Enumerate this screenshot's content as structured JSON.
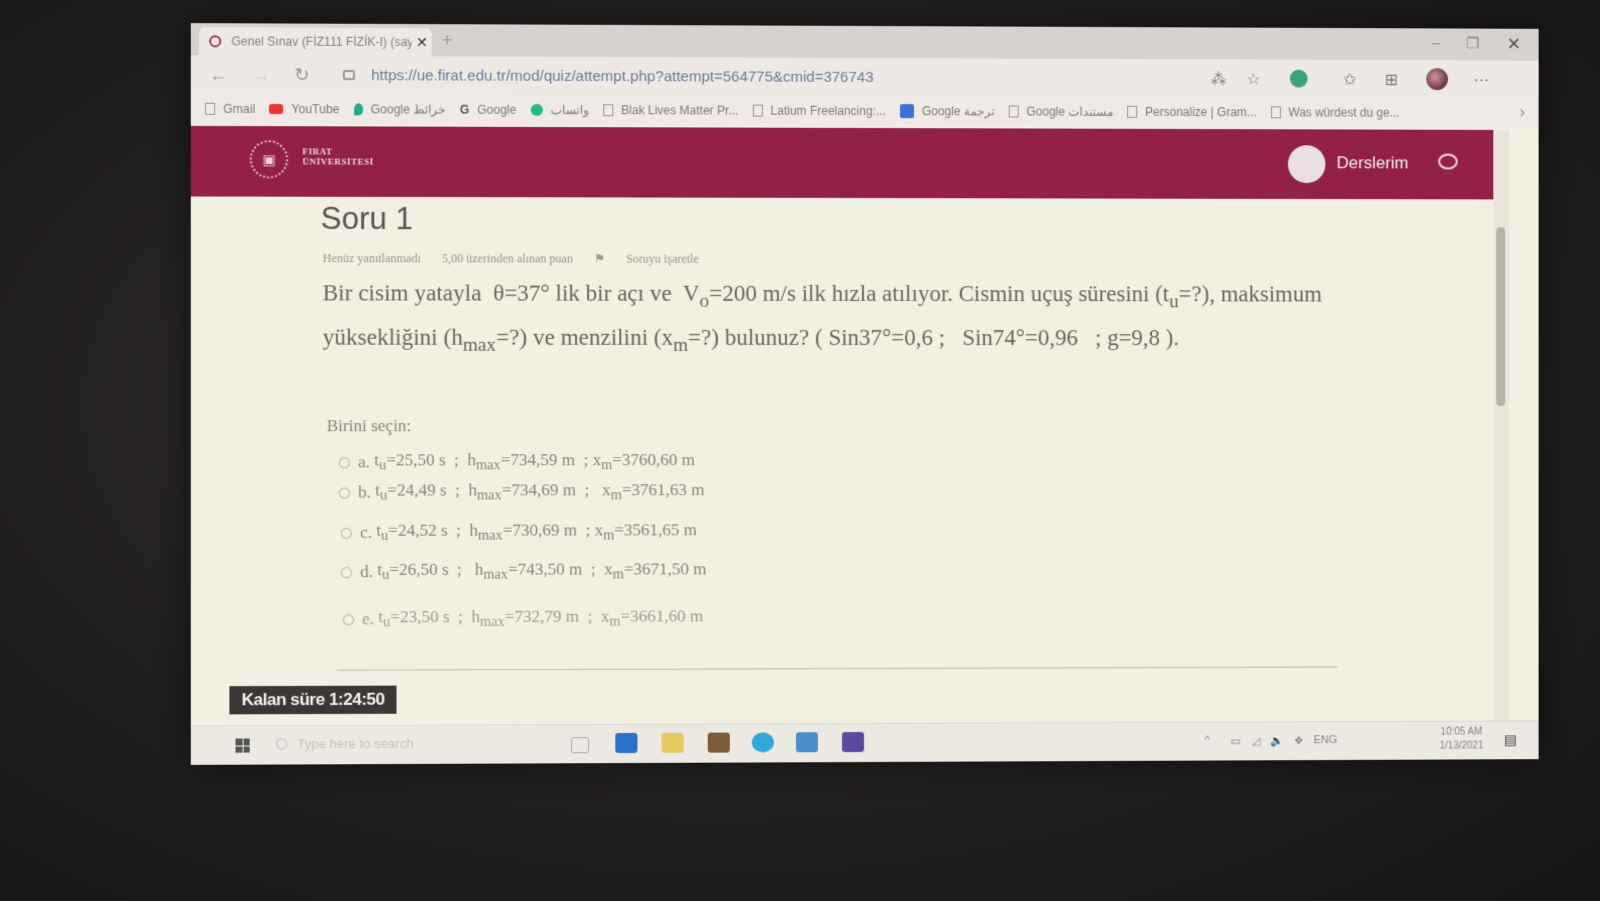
{
  "browser": {
    "tab_title": "Genel Sınav (FİZ111 FİZİK-I) (say",
    "tab_close": "✕",
    "new_tab": "+",
    "url": "https://ue.firat.edu.tr/mod/quiz/attempt.php?attempt=564775&cmid=376743",
    "bookmarks": [
      {
        "label": "Gmail",
        "icon": "page"
      },
      {
        "label": "YouTube",
        "icon": "youtube"
      },
      {
        "label": "Google خرائط",
        "icon": "pin"
      },
      {
        "label": "Google",
        "icon": "g"
      },
      {
        "label": "واتساب",
        "icon": "whatsapp"
      },
      {
        "label": "Blak Lives Matter Pr...",
        "icon": "page"
      },
      {
        "label": "Latium Freelancing:...",
        "icon": "page"
      },
      {
        "label": "Google ترجمة",
        "icon": "translate"
      },
      {
        "label": "Google مستندات",
        "icon": "page"
      },
      {
        "label": "Personalize | Gram...",
        "icon": "page"
      },
      {
        "label": "Was würdest du ge...",
        "icon": "page"
      }
    ]
  },
  "site": {
    "logo_text_1": "FIRAT",
    "logo_text_2": "ÜNİVERSİTESİ",
    "nav_label": "Derslerim",
    "brand_color": "#922048"
  },
  "question": {
    "title": "Soru 1",
    "status": "Henüz yanıtlanmadı",
    "points": "5,00 üzerinden alınan puan",
    "flag": "Soruyu işaretle",
    "text_html": "Bir cisim yatayla&nbsp; θ=37° lik bir açı ve&nbsp; V<sub>o</sub>=200 m/s ilk hızla atılıyor. Cismin uçuş süresini (t<sub>u</sub>=?), maksimum yüksekliğini (h<sub>max</sub>=?) ve menzilini (x<sub>m</sub>=?) bulunuz? ( Sin37°=0,6 ;&nbsp;&nbsp; Sin74°=0,96&nbsp;&nbsp; ; g=9,8 ).",
    "prompt": "Birini seçin:",
    "options": [
      {
        "letter": "a.",
        "html": "t<sub>u</sub>=25,50 s&nbsp; ;&nbsp; h<sub>max</sub>=734,59 m&nbsp; ; x<sub>m</sub>=3760,60 m"
      },
      {
        "letter": "b.",
        "html": "t<sub>u</sub>=24,49 s&nbsp; ;&nbsp; h<sub>max</sub>=734,69 m&nbsp; ;&nbsp;&nbsp; x<sub>m</sub>=3761,63 m"
      },
      {
        "letter": "c.",
        "html": "t<sub>u</sub>=24,52 s&nbsp; ;&nbsp; h<sub>max</sub>=730,69 m&nbsp; ; x<sub>m</sub>=3561,65 m"
      },
      {
        "letter": "d.",
        "html": "t<sub>u</sub>=26,50 s&nbsp; ;&nbsp;&nbsp; h<sub>max</sub>=743,50 m&nbsp; ;&nbsp; x<sub>m</sub>=3671,50 m"
      },
      {
        "letter": "e.",
        "html": "t<sub>u</sub>=23,50 s&nbsp; ;&nbsp; h<sub>max</sub>=732,79 m&nbsp; ;&nbsp; x<sub>m</sub>=3661,60 m"
      }
    ]
  },
  "timer": {
    "label": "Kalan süre 1:24:50"
  },
  "taskbar": {
    "search_placeholder": "Type here to search",
    "lang": "ENG",
    "time": "10:05 AM",
    "date": "1/13/2021"
  }
}
